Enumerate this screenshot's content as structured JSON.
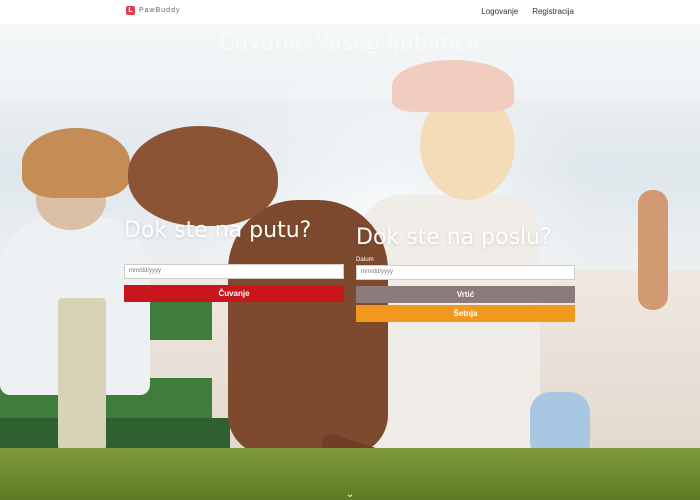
{
  "navbar": {
    "brand_name": "PawBuddy",
    "brand_logo_text": "L",
    "links": [
      "Logovanje",
      "Registracija"
    ]
  },
  "hero": {
    "headline": "Čuvanje Vašeg ljubimca"
  },
  "left_form": {
    "title": "Dok ste na putu?",
    "date_placeholder": "mm/dd/yyyy",
    "button_label": "Čuvanje"
  },
  "right_form": {
    "title": "Dok ste na poslu?",
    "date_label": "Datum",
    "date_placeholder": "mm/dd/yyyy",
    "button_primary_label": "Vrtić",
    "button_secondary_label": "Šetnja"
  },
  "colors": {
    "red": "#c9161d",
    "gray": "#8b7b7a",
    "orange": "#f2981f"
  },
  "icons": {
    "scroll_down": "chevron-down-icon"
  }
}
